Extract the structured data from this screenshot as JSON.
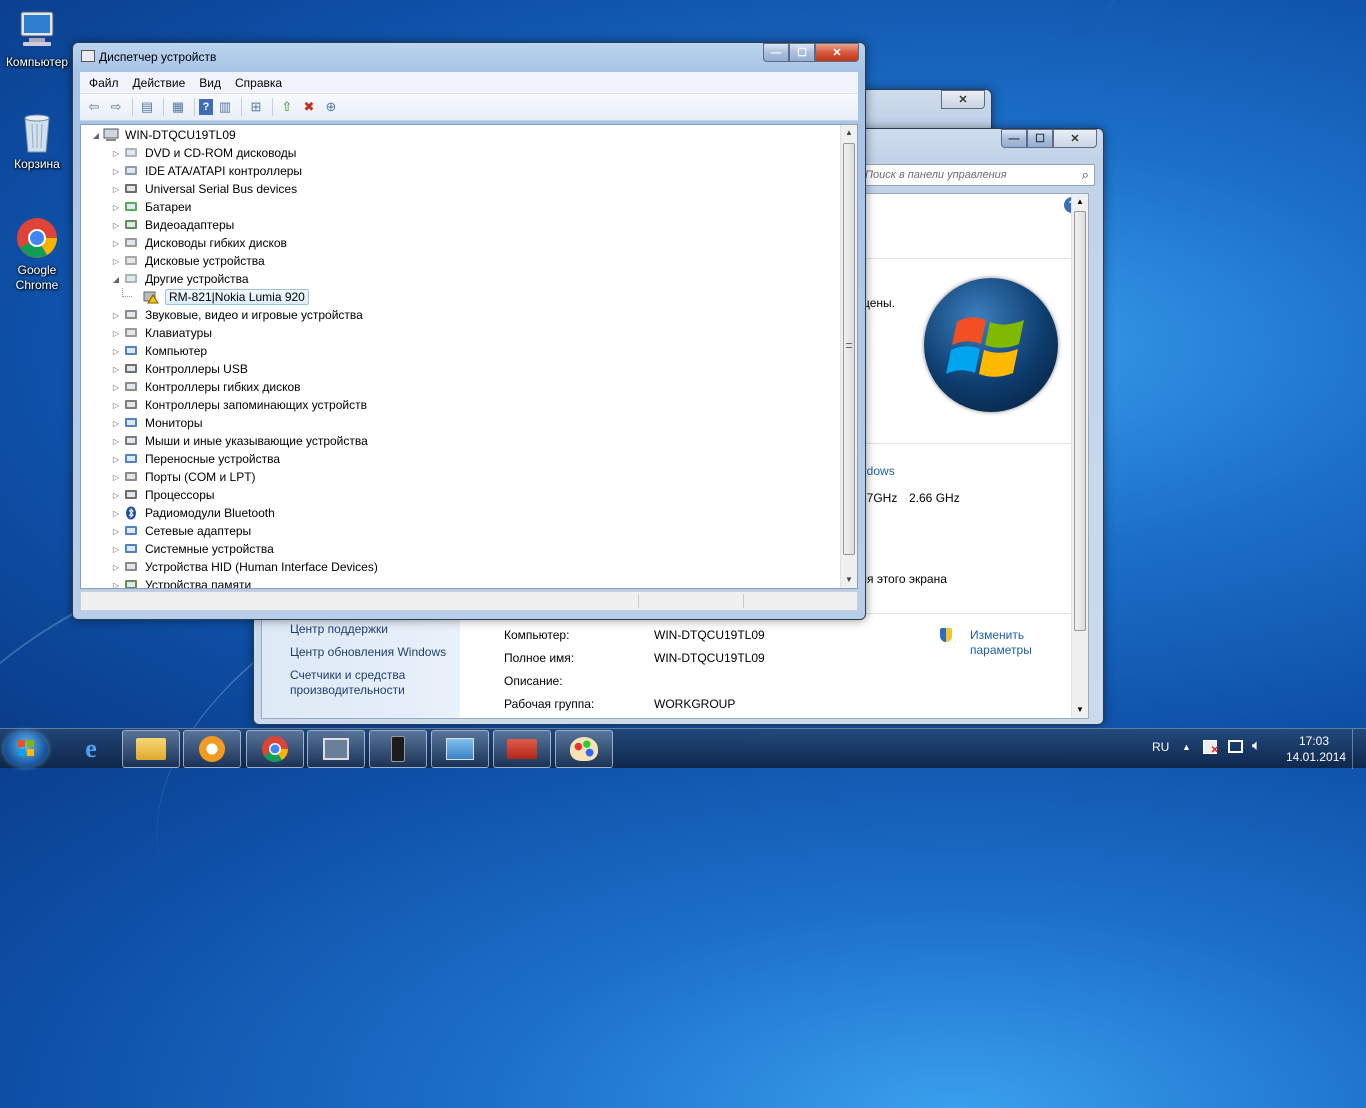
{
  "desktop": {
    "icons": [
      {
        "label": "Компьютер"
      },
      {
        "label": "Корзина"
      },
      {
        "label": "Google Chrome"
      }
    ]
  },
  "device_manager": {
    "title": "Диспетчер устройств",
    "menu": [
      "Файл",
      "Действие",
      "Вид",
      "Справка"
    ],
    "tree": {
      "root": "WIN-DTQCU19TL09",
      "items": [
        {
          "label": "DVD и CD-ROM дисководы",
          "expanded": false,
          "icon": "dvd-drive-icon"
        },
        {
          "label": "IDE ATA/ATAPI контроллеры",
          "expanded": false,
          "icon": "ide-controller-icon"
        },
        {
          "label": "Universal Serial Bus devices",
          "expanded": false,
          "icon": "usb-icon"
        },
        {
          "label": "Батареи",
          "expanded": false,
          "icon": "battery-icon"
        },
        {
          "label": "Видеоадаптеры",
          "expanded": false,
          "icon": "display-adapter-icon"
        },
        {
          "label": "Дисководы гибких дисков",
          "expanded": false,
          "icon": "floppy-icon"
        },
        {
          "label": "Дисковые устройства",
          "expanded": false,
          "icon": "disk-drive-icon"
        },
        {
          "label": "Другие устройства",
          "expanded": true,
          "icon": "unknown-device-icon"
        },
        {
          "label": "RM-821|Nokia Lumia 920",
          "child": true,
          "selected": true,
          "icon": "warning-device-icon"
        },
        {
          "label": "Звуковые, видео и игровые устройства",
          "expanded": false,
          "icon": "speaker-icon"
        },
        {
          "label": "Клавиатуры",
          "expanded": false,
          "icon": "keyboard-icon"
        },
        {
          "label": "Компьютер",
          "expanded": false,
          "icon": "computer-icon"
        },
        {
          "label": "Контроллеры USB",
          "expanded": false,
          "icon": "usb-controller-icon"
        },
        {
          "label": "Контроллеры гибких дисков",
          "expanded": false,
          "icon": "floppy-controller-icon"
        },
        {
          "label": "Контроллеры запоминающих устройств",
          "expanded": false,
          "icon": "storage-controller-icon"
        },
        {
          "label": "Мониторы",
          "expanded": false,
          "icon": "monitor-icon"
        },
        {
          "label": "Мыши и иные указывающие устройства",
          "expanded": false,
          "icon": "mouse-icon"
        },
        {
          "label": "Переносные устройства",
          "expanded": false,
          "icon": "portable-device-icon"
        },
        {
          "label": "Порты (COM и LPT)",
          "expanded": false,
          "icon": "port-icon"
        },
        {
          "label": "Процессоры",
          "expanded": false,
          "icon": "processor-icon"
        },
        {
          "label": "Радиомодули Bluetooth",
          "expanded": false,
          "icon": "bluetooth-icon"
        },
        {
          "label": "Сетевые адаптеры",
          "expanded": false,
          "icon": "network-adapter-icon"
        },
        {
          "label": "Системные устройства",
          "expanded": false,
          "icon": "system-device-icon"
        },
        {
          "label": "Устройства HID (Human Interface Devices)",
          "expanded": false,
          "icon": "hid-icon"
        },
        {
          "label": "Устройства памяти",
          "expanded": false,
          "icon": "memory-icon"
        }
      ]
    }
  },
  "system_window": {
    "search_placeholder": "Поиск в панели управления",
    "partial_texts": {
      "rights": "щены.",
      "windows_link": "ndows",
      "cpu_a": "67GHz",
      "cpu_b": "2.66 GHz",
      "screen": "ля этого экрана"
    },
    "sidebar_links": [
      "Центр поддержки",
      "Центр обновления Windows",
      "Счетчики и средства производительности"
    ],
    "computer_info": [
      {
        "label": "Компьютер:",
        "value": "WIN-DTQCU19TL09"
      },
      {
        "label": "Полное имя:",
        "value": "WIN-DTQCU19TL09"
      },
      {
        "label": "Описание:",
        "value": ""
      },
      {
        "label": "Рабочая группа:",
        "value": "WORKGROUP"
      }
    ],
    "change_settings": "Изменить параметры"
  },
  "taskbar": {
    "language": "RU",
    "time": "17:03",
    "date": "14.01.2014"
  }
}
